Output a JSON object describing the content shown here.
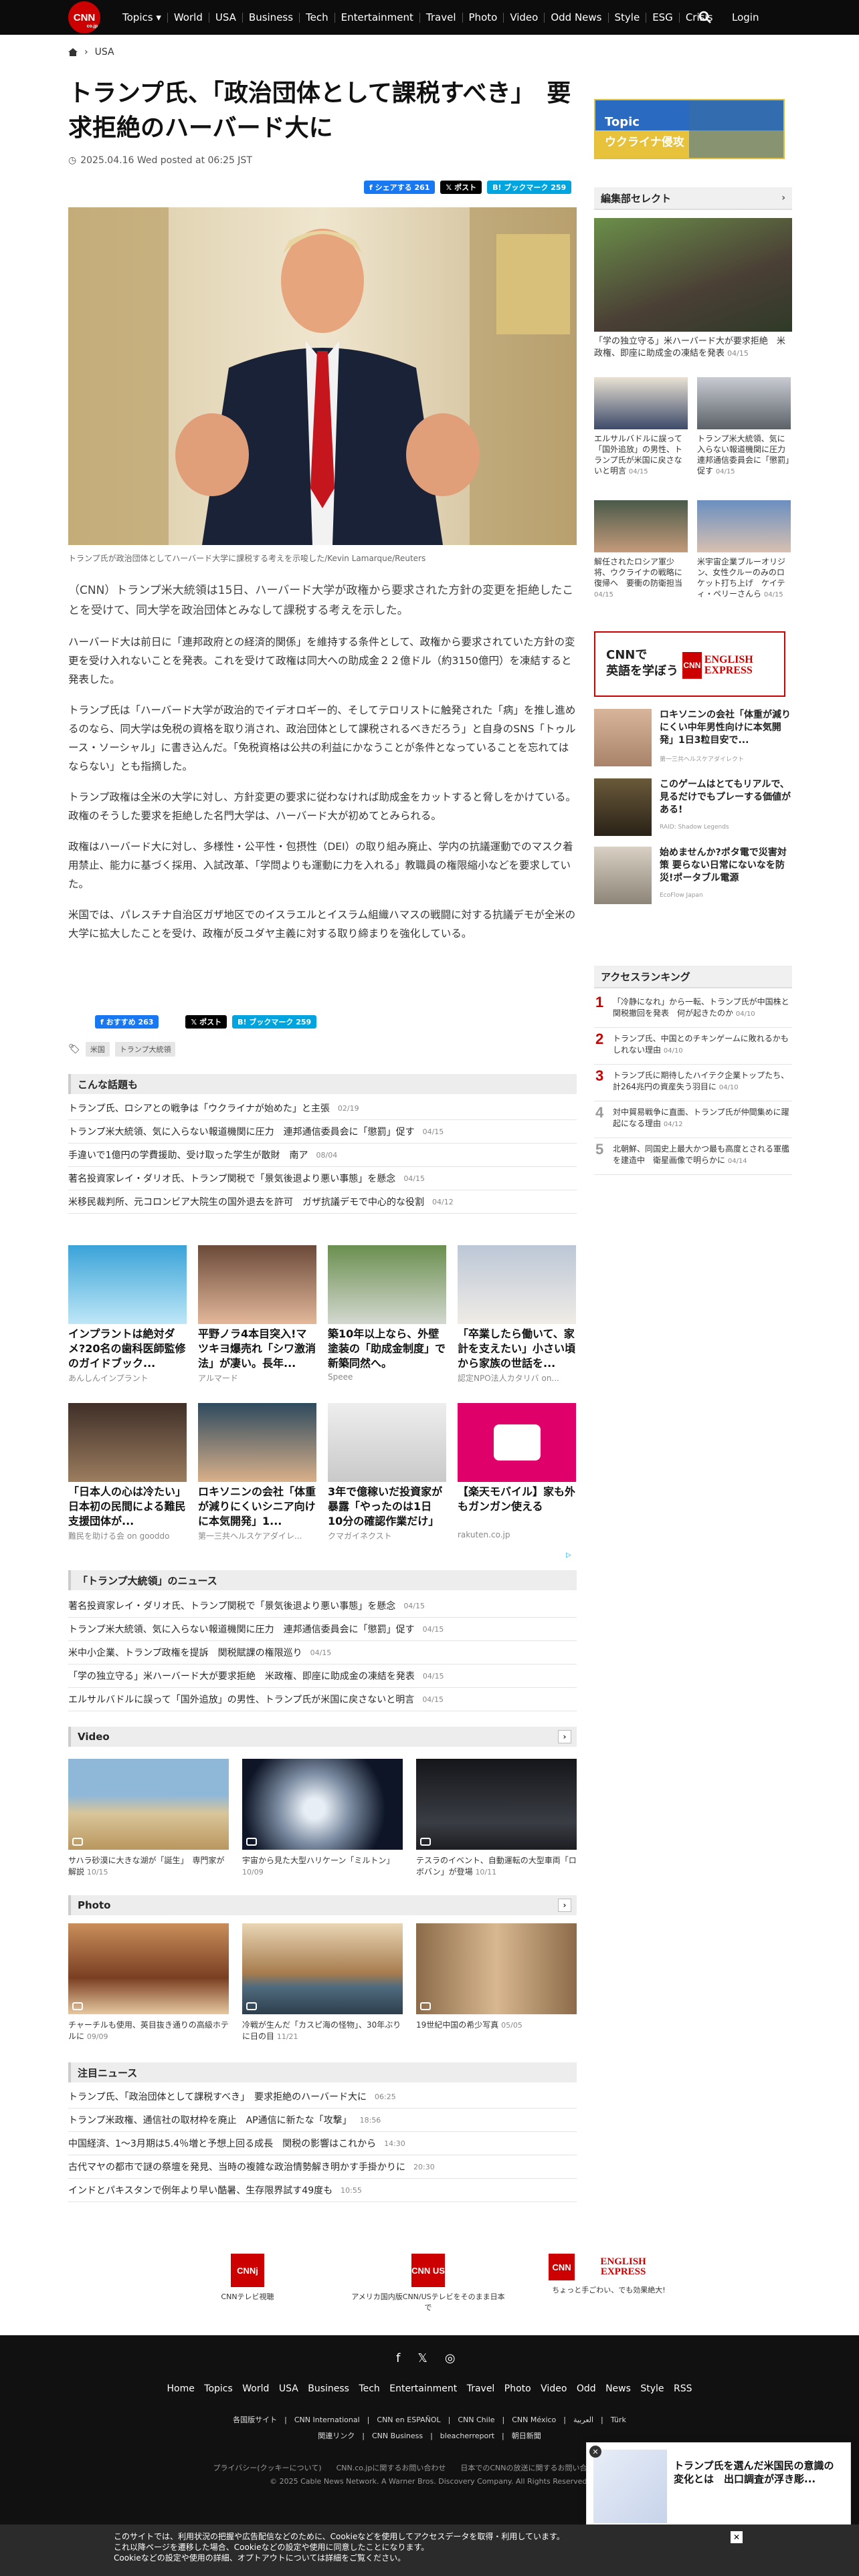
{
  "nav": {
    "items": [
      "Topics",
      "World",
      "USA",
      "Business",
      "Tech",
      "Entertainment",
      "Travel",
      "Photo",
      "Video",
      "Odd News",
      "Style",
      "ESG",
      "Crisis"
    ],
    "login": "Login",
    "logo": "CNN",
    "logo_sub": "co.jp"
  },
  "breadcrumb": {
    "section": "USA"
  },
  "article": {
    "title": "トランプ氏、「政治団体として課税すべき」　要求拒絶のハーバード大に",
    "date": "2025.04.16 Wed posted at 06:25 JST",
    "share": {
      "facebook": "シェアする 261",
      "x": "ポスト",
      "hatena": "ブックマーク 259"
    },
    "share_bottom": {
      "facebook": "おすすめ 263",
      "x": "ポスト",
      "hatena": "ブックマーク 259"
    },
    "caption": "トランプ氏が政治団体としてハーバード大学に課税する考えを示唆した/Kevin Lamarque/Reuters",
    "paragraphs": [
      "（CNN）トランプ米大統領は15日、ハーバード大学が政権から要求された方針の変更を拒絶したことを受けて、同大学を政治団体とみなして課税する考えを示した。",
      "ハーバード大は前日に「連邦政府との経済的関係」を維持する条件として、政権から要求されていた方針の変更を受け入れないことを発表。これを受けて政権は同大への助成金２２億ドル（約3150億円）を凍結すると発表した。",
      "トランプ氏は「ハーバード大学が政治的でイデオロギー的、そしてテロリストに触発された「病」を推し進めるのなら、同大学は免税の資格を取り消され、政治団体として課税されるべきだろう」と自身のSNS「トゥルース・ソーシャル」に書き込んだ。「免税資格は公共の利益にかなうことが条件となっていることを忘れてはならない」とも指摘した。",
      "トランプ政権は全米の大学に対し、方針変更の要求に従わなければ助成金をカットすると脅しをかけている。政権のそうした要求を拒絶した名門大学は、ハーバード大が初めてとみられる。",
      "政権はハーバード大に対し、多様性・公平性・包摂性（DEI）の取り組み廃止、学内の抗議運動でのマスク着用禁止、能力に基づく採用、入試改革、「学問よりも運動に力を入れる」教職員の権限縮小などを要求していた。",
      "米国では、パレスチナ自治区ガザ地区でのイスラエルとイスラム組織ハマスの戦闘に対する抗議デモが全米の大学に拡大したことを受け、政権が反ユダヤ主義に対する取り締まりを強化している。"
    ],
    "tags": [
      "米国",
      "トランプ大統領"
    ]
  },
  "related": {
    "title": "こんな話題も",
    "items": [
      {
        "text": "トランプ氏、ロシアとの戦争は「ウクライナが始めた」と主張",
        "date": "02/19"
      },
      {
        "text": "トランプ米大統領、気に入らない報道機関に圧力　連邦通信委員会に「懲罰」促す",
        "date": "04/15"
      },
      {
        "text": "手違いで1億円の学費援助、受け取った学生が散財　南ア",
        "date": "08/04"
      },
      {
        "text": "著名投資家レイ・ダリオ氏、トランプ関税で「景気後退より悪い事態」を懸念",
        "date": "04/15"
      },
      {
        "text": "米移民裁判所、元コロンビア大院生の国外退去を許可　ガザ抗議デモで中心的な役割",
        "date": "04/12"
      }
    ]
  },
  "ads": [
    {
      "title": "インプラントは絶対ダメ?20名の歯科医師監修のガイドブック...",
      "source": "あんしんインプラント"
    },
    {
      "title": "平野ノラ4本目突入!マツキヨ爆売れ「シワ激消法」が凄い。長年...",
      "source": "アルマード"
    },
    {
      "title": "築10年以上なら、外壁塗装の「助成金制度」で新築同然へ。",
      "source": "Speee"
    },
    {
      "title": "「卒業したら働いて、家計を支えたい」小さい頃から家族の世話を...",
      "source": "認定NPO法人カタリバ on..."
    },
    {
      "title": "「日本人の心は冷たい」日本初の民間による難民支援団体が...",
      "source": "難民を助ける会 on gooddo"
    },
    {
      "title": "ロキソニンの会社「体重が減りにくいシニア向けに本気開発」1...",
      "source": "第一三共ヘルスケアダイレ..."
    },
    {
      "title": "3年で億稼いだ投資家が暴露「やったのは1日10分の確認作業だけ」",
      "source": "クマガイネクスト"
    },
    {
      "title": "【楽天モバイル】家も外もガンガン使える",
      "source": "rakuten.co.jp"
    }
  ],
  "trump_news": {
    "title": "「トランプ大統領」のニュース",
    "items": [
      {
        "text": "著名投資家レイ・ダリオ氏、トランプ関税で「景気後退より悪い事態」を懸念",
        "date": "04/15"
      },
      {
        "text": "トランプ米大統領、気に入らない報道機関に圧力　連邦通信委員会に「懲罰」促す",
        "date": "04/15"
      },
      {
        "text": "米中小企業、トランプ政権を提訴　関税賦課の権限巡り",
        "date": "04/15"
      },
      {
        "text": "「学の独立守る」米ハーバード大が要求拒絶　米政権、即座に助成金の凍結を発表",
        "date": "04/15"
      },
      {
        "text": "エルサルバドルに誤って「国外追放」の男性、トランプ氏が米国に戻さないと明言",
        "date": "04/15"
      }
    ]
  },
  "video": {
    "title": "Video",
    "items": [
      {
        "text": "サハラ砂漠に大きな湖が「誕生」　専門家が解説",
        "date": "10/15"
      },
      {
        "text": "宇宙から見た大型ハリケーン「ミルトン」",
        "date": "10/09"
      },
      {
        "text": "テスラのイベント、自動運転の大型車両「ロボバン」が登場",
        "date": "10/11"
      }
    ]
  },
  "photo": {
    "title": "Photo",
    "items": [
      {
        "text": "チャーチルも使用、英目抜き通りの高級ホテルに",
        "date": "09/09"
      },
      {
        "text": "冷戦が生んだ「カスピ海の怪物」、30年ぶりに日の目",
        "date": "11/21"
      },
      {
        "text": "19世紀中国の希少写真",
        "date": "05/05"
      }
    ]
  },
  "hot": {
    "title": "注目ニュース",
    "items": [
      {
        "text": "トランプ氏、「政治団体として課税すべき」　要求拒絶のハーバード大に",
        "date": "06:25"
      },
      {
        "text": "トランプ米政権、通信社の取材枠を廃止　AP通信に新たな「攻撃」",
        "date": "18:56"
      },
      {
        "text": "中国経済、1～3月期は5.4％増と予想上回る成長　関税の影響はこれから",
        "date": "14:30"
      },
      {
        "text": "古代マヤの都市で謎の祭壇を発見、当時の複雑な政治情勢解き明かす手掛かりに",
        "date": "20:30"
      },
      {
        "text": "インドとパキスタンで例年より早い酷暑、生存限界試す49度も",
        "date": "10:55"
      }
    ]
  },
  "sidebar": {
    "topic": {
      "label": "Topic",
      "title": "ウクライナ侵攻"
    },
    "editors_pick": "編集部セレクト",
    "feature": {
      "text": "「学の独立守る」米ハーバード大が要求拒絶　米政権、即座に助成金の凍結を発表",
      "date": "04/15"
    },
    "cards": [
      {
        "text": "エルサルバドルに誤って「国外追放」の男性、トランプ氏が米国に戻さないと明言",
        "date": "04/15"
      },
      {
        "text": "トランプ米大統領、気に入らない報道機関に圧力　連邦通信委員会に「懲罰」促す",
        "date": "04/15"
      },
      {
        "text": "解任されたロシア軍少将、ウクライナの戦略に復帰へ　要衝の防衛担当",
        "date": "04/15"
      },
      {
        "text": "米宇宙企業ブルーオリジン、女性クルーのみのロケット打ち上げ　ケイティ・ペリーさんら",
        "date": "04/15"
      }
    ],
    "english_ad": {
      "line1": "CNNで",
      "line2": "英語を学ぼう",
      "logo": "ENGLISH EXPRESS"
    },
    "sponsored": [
      {
        "text": "ロキソニンの会社「体重が減りにくい中年男性向けに本気開発」1日3粒目安で...",
        "source": "第一三共ヘルスケアダイレクト"
      },
      {
        "text": "このゲームはとてもリアルで、見るだけでもプレーする価値がある!",
        "source": "RAID: Shadow Legends"
      },
      {
        "text": "始めませんか?ポタ電で災害対策 要らない日常にないなを防災!ポータブル電源",
        "source": "EcoFlow Japan"
      }
    ],
    "ranking_title": "アクセスランキング",
    "ranking": [
      {
        "n": "1",
        "text": "「冷静になれ」から一転、トランプ氏が中国株と関税撤回を発表　何が起きたのか",
        "date": "04/10"
      },
      {
        "n": "2",
        "text": "トランプ氏、中国とのチキンゲームに敗れるかもしれない理由",
        "date": "04/10"
      },
      {
        "n": "3",
        "text": "トランプ氏に期待したハイテク企業トップたち、計264兆円の資産失う羽目に",
        "date": "04/10"
      },
      {
        "n": "4",
        "text": "対中貿易戦争に直面、トランプ氏が仲間集めに躍起になる理由",
        "date": "04/12"
      },
      {
        "n": "5",
        "text": "北朝鮮、同国史上最大かつ最も高度とされる軍艦を建造中　衛星画像で明らかに",
        "date": "04/14"
      }
    ]
  },
  "bottom_logos": [
    {
      "mark": "CNNj",
      "text": "CNNテレビ視聴"
    },
    {
      "mark": "CNN US",
      "text": "アメリカ国内版CNN/USテレビをそのまま日本で"
    },
    {
      "mark": "CNN",
      "text": "ちょっと手ごわい、でも効果絶大!"
    }
  ],
  "footer": {
    "nav": "Home Topics World USA Business Tech Entertainment Travel Photo Video Odd News Style RSS",
    "nav2": "各国版サイト　|　CNN International　|　CNN en ESPAÑOL　|　CNN Chile　|　CNN México　|　العربية　|　Türk",
    "nav3": "関連リンク　|　CNN Business　|　bleacherreport　|　朝日新聞",
    "nav4": "プライバシー(クッキーについて)　　CNN.co.jpに関するお問い合わせ　　日本でのCNNの放送に関するお問い合わせ　　広告掲載",
    "copyright": "© 2025 Cable News Network. A Warner Bros. Discovery Company. All Rights Reserved."
  },
  "cookie": {
    "l1": "このサイトでは、利用状況の把握や広告配信などのために、Cookieなどを使用してアクセスデータを取得・利用しています。",
    "l2": "これ以降ページを遷移した場合、Cookieなどの設定や使用に同意したことになります。",
    "l3": "Cookieなどの設定や使用の詳細、オプトアウトについては詳細をご覧ください。"
  },
  "popup": {
    "text": "トランプ氏を選んだ米国民の意識の変化とは　出口調査が浮き彫..."
  }
}
